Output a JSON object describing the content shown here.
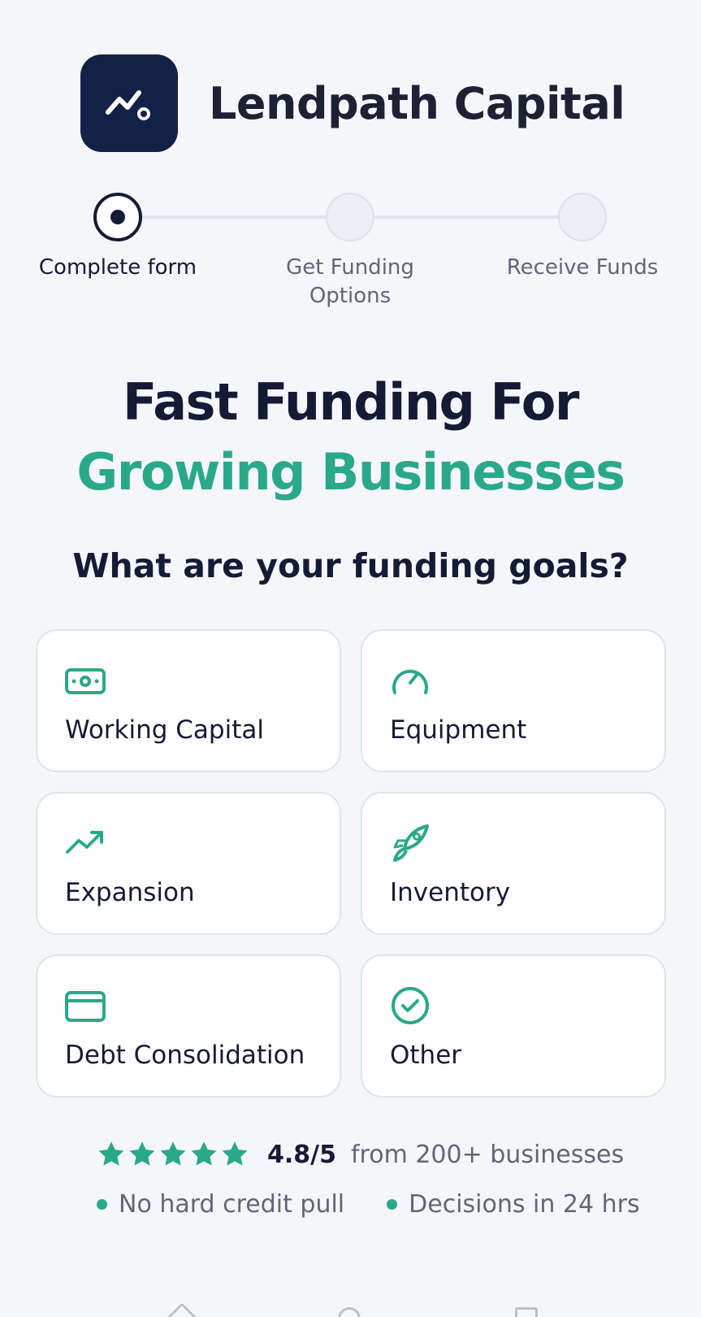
{
  "brand": {
    "name": "Lendpath Capital",
    "logo_icon": "chart-trend-icon",
    "logo_bg": "#142146"
  },
  "stepper": {
    "steps": [
      {
        "label": "Complete form",
        "state": "active"
      },
      {
        "label": "Get Funding Options",
        "state": "upcoming"
      },
      {
        "label": "Receive Funds",
        "state": "upcoming"
      }
    ]
  },
  "headline": {
    "main": "Fast Funding For ",
    "accent": "Growing Businesses"
  },
  "question": "What are your funding goals?",
  "options": [
    {
      "label": "Working Capital",
      "icon": "cash-icon"
    },
    {
      "label": "Equipment",
      "icon": "gauge-icon"
    },
    {
      "label": "Expansion",
      "icon": "trending-up-icon"
    },
    {
      "label": "Inventory",
      "icon": "rocket-icon"
    },
    {
      "label": "Debt Consolidation",
      "icon": "credit-card-icon"
    },
    {
      "label": "Other",
      "icon": "check-circle-icon"
    }
  ],
  "rating": {
    "stars": 5,
    "score": "4.8/5",
    "text": "from 200+ businesses"
  },
  "bullets": [
    "No hard credit pull",
    "Decisions in 24 hrs"
  ],
  "colors": {
    "accent": "#2aa88a",
    "primary": "#141b34",
    "background": "#f4f6fa"
  }
}
